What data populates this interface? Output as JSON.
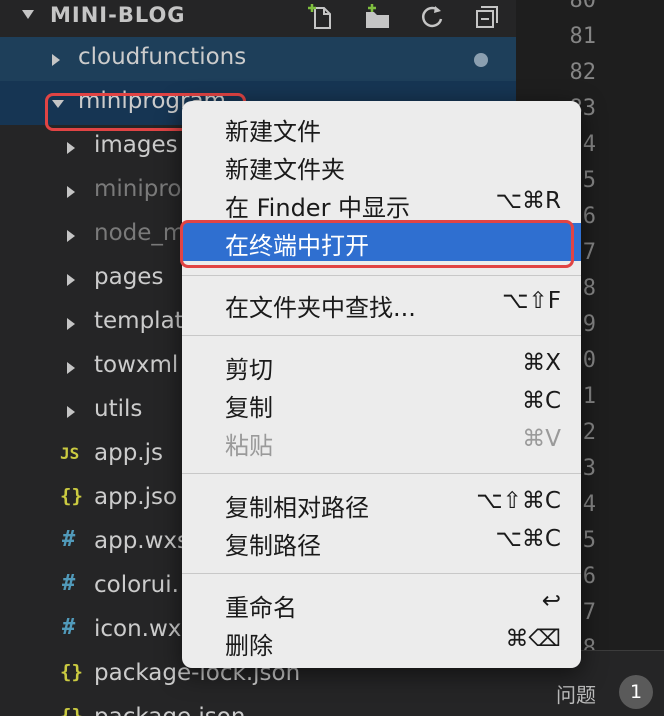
{
  "explorer": {
    "title": "MINI-BLOG",
    "toolbar": [
      "new-file-icon",
      "new-folder-icon",
      "refresh-icon",
      "collapse-all-icon"
    ]
  },
  "tree": {
    "items": [
      {
        "label": "cloudfunctions",
        "type": "folder",
        "expanded": false
      },
      {
        "label": "miniprogram",
        "type": "folder",
        "expanded": true
      },
      {
        "label": "images",
        "type": "folder"
      },
      {
        "label": "minipro",
        "type": "folder"
      },
      {
        "label": "node_m",
        "type": "folder"
      },
      {
        "label": "pages",
        "type": "folder"
      },
      {
        "label": "templat",
        "type": "folder"
      },
      {
        "label": "towxml",
        "type": "folder"
      },
      {
        "label": "utils",
        "type": "folder"
      },
      {
        "label": "app.js",
        "type": "file",
        "icon": "JS"
      },
      {
        "label": "app.jso",
        "type": "file",
        "icon": "{}"
      },
      {
        "label": "app.wxs",
        "type": "file",
        "icon": "#"
      },
      {
        "label": "colorui.",
        "type": "file",
        "icon": "#"
      },
      {
        "label": "icon.wx",
        "type": "file",
        "icon": "#"
      },
      {
        "label": "package-lock.json",
        "type": "file",
        "icon": "{}"
      },
      {
        "label": "package.json",
        "type": "file",
        "icon": "{}"
      }
    ]
  },
  "editor": {
    "line_numbers": [
      "80",
      "81",
      "82",
      "83",
      "4",
      "5",
      "6",
      "7",
      "8",
      "9",
      "0",
      "1",
      "2",
      "3",
      "4",
      "5",
      "6",
      "7",
      "8"
    ]
  },
  "panel": {
    "problems_label": "问题",
    "problems_count": "1"
  },
  "context_menu": {
    "groups": [
      [
        {
          "label": "新建文件",
          "shortcut": ""
        },
        {
          "label": "新建文件夹",
          "shortcut": ""
        },
        {
          "label": "在 Finder 中显示",
          "shortcut": "⌥⌘R"
        },
        {
          "label": "在终端中打开",
          "shortcut": "",
          "selected": true
        }
      ],
      [
        {
          "label": "在文件夹中查找...",
          "shortcut": "⌥⇧F"
        }
      ],
      [
        {
          "label": "剪切",
          "shortcut": "⌘X"
        },
        {
          "label": "复制",
          "shortcut": "⌘C"
        },
        {
          "label": "粘贴",
          "shortcut": "⌘V",
          "disabled": true
        }
      ],
      [
        {
          "label": "复制相对路径",
          "shortcut": "⌥⇧⌘C"
        },
        {
          "label": "复制路径",
          "shortcut": "⌥⌘C"
        }
      ],
      [
        {
          "label": "重命名",
          "shortcut": "↩"
        },
        {
          "label": "删除",
          "shortcut": "⌘⌫"
        }
      ]
    ]
  },
  "colors": {
    "sidebar_bg": "#252526",
    "editor_bg": "#1e1e1e",
    "row_highlight": "#1e3f5a",
    "menu_bg": "#ececec",
    "menu_selected": "#2f6fd0",
    "annotation_red": "#e14444",
    "js_icon": "#cbcb41",
    "json_icon": "#cbcb41",
    "css_icon": "#519aba"
  }
}
